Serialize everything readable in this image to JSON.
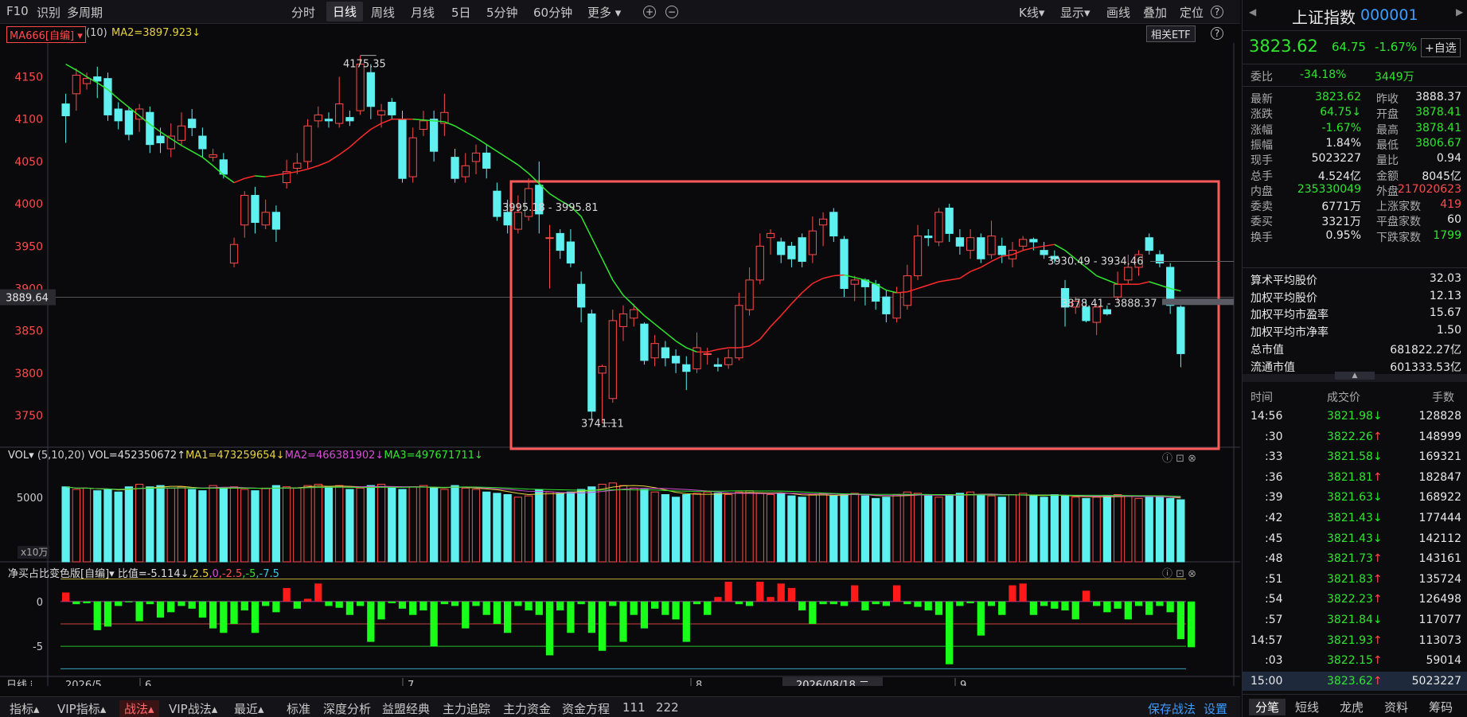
{
  "toolbar": {
    "f10": "F10",
    "identify": "识别",
    "multi_period": "多周期",
    "tabs": [
      "分时",
      "日线",
      "周线",
      "月线",
      "5日",
      "5分钟",
      "60分钟",
      "更多"
    ],
    "active_tab": "日线",
    "zoom_in": "+",
    "zoom_out": "−",
    "right_items": [
      "K线",
      "显示",
      "画线",
      "叠加",
      "定位"
    ],
    "help": "?"
  },
  "info": {
    "indicator_badge": "MA666[自编]",
    "period": "(10)",
    "ma2": "MA2=3897.923↓",
    "etf_button": "相关ETF"
  },
  "price_axis": {
    "labels": [
      "4150",
      "4100",
      "4050",
      "4000",
      "3950",
      "3900",
      "3850",
      "3800",
      "3750"
    ],
    "current": "3889.64"
  },
  "annotations": {
    "high": "4175.35",
    "low": "3741.11",
    "range1": "3995.18 - 3995.81",
    "range2": "3930.49 - 3934.46",
    "range3": "3878.41 - 3888.37"
  },
  "volume": {
    "label": "VOL",
    "params": "(5,10,20)",
    "vol": "VOL=452350672↑",
    "ma1": "MA1=473259654↓",
    "ma2": "MA2=466381902↓",
    "ma3": "MA3=497671711↓",
    "axis_label": "5000",
    "unit": "x10万"
  },
  "netbuy": {
    "label": "净买占比变色版[自编]",
    "ratio": "比值=-5.114↓",
    "levels": [
      "2.5",
      "0",
      "-2.5",
      "-5",
      "-7.5"
    ],
    "axis": [
      "0",
      "-5"
    ]
  },
  "xaxis": {
    "labels": [
      "2026/5",
      "6",
      "7",
      "8",
      "9"
    ],
    "cursor_date": "2026/08/18,二",
    "period": "日线"
  },
  "bottom": {
    "items": [
      "指标",
      "VIP指标",
      "战法",
      "VIP战法",
      "最近",
      "标准",
      "深度分析",
      "益盟经典",
      "主力追踪",
      "主力资金",
      "资金方程",
      "111",
      "222"
    ],
    "save": "保存战法",
    "settings": "设置"
  },
  "right": {
    "title": "上证指数",
    "code": "000001",
    "price": "3823.62",
    "change": "64.75",
    "pct": "-1.67%",
    "add_watch": "+自选",
    "wb": {
      "label": "委比",
      "val": "-34.18%",
      "val2": "3449万"
    },
    "kv": [
      [
        "最新",
        "3823.62",
        "昨收",
        "3888.37"
      ],
      [
        "涨跌",
        "64.75↓",
        "开盘",
        "3878.41"
      ],
      [
        "涨幅",
        "-1.67%",
        "最高",
        "3878.41"
      ],
      [
        "振幅",
        "1.84%",
        "最低",
        "3806.67"
      ],
      [
        "现手",
        "5023227",
        "量比",
        "0.94"
      ],
      [
        "总手",
        "4.524亿",
        "金额",
        "8045亿"
      ],
      [
        "内盘",
        "235330049",
        "外盘",
        "217020623"
      ],
      [
        "委卖",
        "6771万",
        "上涨家数",
        "419"
      ],
      [
        "委买",
        "3321万",
        "平盘家数",
        "60"
      ],
      [
        "换手",
        "0.95%",
        "下跌家数",
        "1799"
      ]
    ],
    "stats": [
      [
        "算术平均股价",
        "32.03"
      ],
      [
        "加权平均股价",
        "12.13"
      ],
      [
        "加权平均市盈率",
        "15.67"
      ],
      [
        "加权平均市净率",
        "1.50"
      ],
      [
        "总市值",
        "681822.27亿"
      ],
      [
        "流通市值",
        "601333.53亿"
      ]
    ],
    "ticks_header": [
      "时间",
      "成交价",
      "手数"
    ],
    "ticks": [
      [
        "14:56",
        "3821.98↓",
        "128828"
      ],
      [
        ":30",
        "3822.26↑",
        "148999"
      ],
      [
        ":33",
        "3821.58↓",
        "169321"
      ],
      [
        ":36",
        "3821.81↑",
        "182847"
      ],
      [
        ":39",
        "3821.63↓",
        "168922"
      ],
      [
        ":42",
        "3821.43↓",
        "177444"
      ],
      [
        ":45",
        "3821.43↓",
        "142112"
      ],
      [
        ":48",
        "3821.73↑",
        "143161"
      ],
      [
        ":51",
        "3821.83↑",
        "135724"
      ],
      [
        ":54",
        "3822.23↑",
        "126498"
      ],
      [
        ":57",
        "3821.84↓",
        "117077"
      ],
      [
        "14:57",
        "3821.93↑",
        "113073"
      ],
      [
        ":03",
        "3822.15↑",
        "59014"
      ],
      [
        "15:00",
        "3823.62↑",
        "5023227"
      ]
    ],
    "tabs": [
      "分笔",
      "短线",
      "龙虎",
      "资料",
      "筹码"
    ]
  },
  "chart_data": {
    "type": "candlestick",
    "title": "上证指数 000001 日线",
    "ylim": [
      3720,
      4190
    ],
    "candles": [
      [
        4118,
        4104,
        4130,
        4072
      ],
      [
        4130,
        4152,
        4160,
        4110
      ],
      [
        4142,
        4148,
        4155,
        4135
      ],
      [
        4150,
        4145,
        4162,
        4125
      ],
      [
        4148,
        4105,
        4155,
        4098
      ],
      [
        4112,
        4098,
        4120,
        4088
      ],
      [
        4110,
        4082,
        4115,
        4075
      ],
      [
        4100,
        4112,
        4118,
        4085
      ],
      [
        4108,
        4070,
        4115,
        4060
      ],
      [
        4080,
        4072,
        4090,
        4060
      ],
      [
        4065,
        4080,
        4095,
        4055
      ],
      [
        4075,
        4092,
        4108,
        4068
      ],
      [
        4100,
        4090,
        4112,
        4080
      ],
      [
        4080,
        4065,
        4090,
        4055
      ],
      [
        4055,
        4058,
        4065,
        4050
      ],
      [
        4052,
        4035,
        4060,
        4030
      ],
      [
        3930,
        3952,
        3960,
        3925
      ],
      [
        3975,
        4010,
        4015,
        3960
      ],
      [
        4010,
        3978,
        4020,
        3965
      ],
      [
        3975,
        3990,
        4005,
        3970
      ],
      [
        3990,
        3970,
        3998,
        3955
      ],
      [
        4025,
        4038,
        4052,
        4018
      ],
      [
        4042,
        4048,
        4060,
        4035
      ],
      [
        4050,
        4092,
        4100,
        4042
      ],
      [
        4098,
        4105,
        4115,
        4090
      ],
      [
        4100,
        4098,
        4108,
        4090
      ],
      [
        4095,
        4118,
        4150,
        4090
      ],
      [
        4102,
        4098,
        4110,
        4092
      ],
      [
        4110,
        4165,
        4175,
        4105
      ],
      [
        4155,
        4115,
        4165,
        4100
      ],
      [
        4105,
        4110,
        4118,
        4090
      ],
      [
        4120,
        4105,
        4125,
        4100
      ],
      [
        4100,
        4030,
        4110,
        4025
      ],
      [
        4032,
        4078,
        4090,
        4025
      ],
      [
        4088,
        4098,
        4110,
        4080
      ],
      [
        4100,
        4062,
        4110,
        4050
      ],
      [
        4095,
        4108,
        4130,
        4080
      ],
      [
        4055,
        4030,
        4065,
        4025
      ],
      [
        4032,
        4045,
        4060,
        4025
      ],
      [
        4050,
        4060,
        4070,
        4035
      ],
      [
        4060,
        4042,
        4070,
        4030
      ],
      [
        4015,
        3985,
        4025,
        3980
      ],
      [
        3990,
        3975,
        4005,
        3965
      ],
      [
        3970,
        3990,
        4010,
        3965
      ],
      [
        3985,
        4018,
        4030,
        3980
      ],
      [
        4022,
        3988,
        4050,
        3965
      ],
      [
        3960,
        3960,
        3975,
        3900
      ],
      [
        3965,
        3945,
        3970,
        3935
      ],
      [
        3955,
        3930,
        3970,
        3925
      ],
      [
        3905,
        3878,
        3920,
        3860
      ],
      [
        3870,
        3755,
        3875,
        3745
      ],
      [
        3800,
        3808,
        3810,
        3741
      ],
      [
        3770,
        3862,
        3875,
        3765
      ],
      [
        3855,
        3870,
        3880,
        3838
      ],
      [
        3865,
        3875,
        3882,
        3855
      ],
      [
        3858,
        3815,
        3860,
        3810
      ],
      [
        3818,
        3835,
        3845,
        3808
      ],
      [
        3830,
        3818,
        3838,
        3808
      ],
      [
        3820,
        3812,
        3828,
        3800
      ],
      [
        3810,
        3802,
        3820,
        3780
      ],
      [
        3805,
        3830,
        3848,
        3800
      ],
      [
        3822,
        3823,
        3830,
        3810
      ],
      [
        3810,
        3808,
        3818,
        3802
      ],
      [
        3810,
        3818,
        3828,
        3805
      ],
      [
        3818,
        3880,
        3895,
        3815
      ],
      [
        3875,
        3910,
        3925,
        3868
      ],
      [
        3910,
        3950,
        3965,
        3905
      ],
      [
        3960,
        3965,
        3970,
        3940
      ],
      [
        3955,
        3940,
        3960,
        3930
      ],
      [
        3950,
        3935,
        3955,
        3925
      ],
      [
        3960,
        3932,
        3965,
        3925
      ],
      [
        3940,
        3968,
        3985,
        3930
      ],
      [
        3975,
        3982,
        3990,
        3950
      ],
      [
        3990,
        3962,
        3995,
        3955
      ],
      [
        3958,
        3900,
        3962,
        3890
      ],
      [
        3905,
        3910,
        3915,
        3885
      ],
      [
        3910,
        3902,
        3912,
        3880
      ],
      [
        3905,
        3885,
        3910,
        3875
      ],
      [
        3890,
        3870,
        3898,
        3860
      ],
      [
        3865,
        3895,
        3902,
        3860
      ],
      [
        3880,
        3915,
        3928,
        3875
      ],
      [
        3915,
        3962,
        3975,
        3910
      ],
      [
        3962,
        3960,
        3970,
        3950
      ],
      [
        3955,
        3990,
        3995,
        3950
      ],
      [
        3995,
        3965,
        4000,
        3955
      ],
      [
        3960,
        3950,
        3970,
        3940
      ],
      [
        3945,
        3960,
        3970,
        3935
      ],
      [
        3960,
        3935,
        3965,
        3930
      ],
      [
        3940,
        3962,
        3980,
        3935
      ],
      [
        3950,
        3940,
        3960,
        3930
      ],
      [
        3935,
        3945,
        3955,
        3925
      ],
      [
        3950,
        3958,
        3962,
        3945
      ],
      [
        3958,
        3955,
        3960,
        3945
      ],
      [
        3945,
        3940,
        3955,
        3935
      ],
      [
        3938,
        3935,
        3945,
        3930
      ],
      [
        3900,
        3878,
        3910,
        3855
      ],
      [
        3878,
        3885,
        3890,
        3870
      ],
      [
        3878,
        3862,
        3885,
        3860
      ],
      [
        3860,
        3878,
        3882,
        3845
      ],
      [
        3875,
        3870,
        3880,
        3868
      ],
      [
        3890,
        3905,
        3920,
        3885
      ],
      [
        3910,
        3925,
        3940,
        3905
      ],
      [
        3925,
        3940,
        3945,
        3915
      ],
      [
        3960,
        3945,
        3965,
        3940
      ],
      [
        3940,
        3930,
        3945,
        3925
      ],
      [
        3925,
        3880,
        3930,
        3870
      ],
      [
        3878,
        3823,
        3880,
        3807
      ]
    ],
    "ma2": [
      4165,
      4158,
      4150,
      4143,
      4135,
      4124,
      4114,
      4104,
      4094,
      4085,
      4077,
      4069,
      4062,
      4055,
      4045,
      4034,
      4025,
      4030,
      4033,
      4032,
      4034,
      4036,
      4038,
      4041,
      4045,
      4050,
      4058,
      4067,
      4078,
      4088,
      4095,
      4100,
      4100,
      4100,
      4099,
      4098,
      4097,
      4092,
      4085,
      4078,
      4070,
      4062,
      4054,
      4046,
      4036,
      4024,
      4012,
      4004,
      3997,
      3985,
      3960,
      3935,
      3910,
      3892,
      3880,
      3868,
      3858,
      3848,
      3838,
      3830,
      3825,
      3825,
      3828,
      3830,
      3830,
      3832,
      3840,
      3855,
      3868,
      3882,
      3895,
      3906,
      3912,
      3915,
      3916,
      3913,
      3910,
      3905,
      3898,
      3895,
      3896,
      3900,
      3904,
      3908,
      3910,
      3912,
      3920,
      3925,
      3932,
      3938,
      3940,
      3945,
      3948,
      3950,
      3952,
      3945,
      3935,
      3925,
      3915,
      3910,
      3905,
      3905,
      3905,
      3908,
      3904,
      3900,
      3897
    ],
    "volume": {
      "ylim": [
        0,
        8000
      ],
      "values": [
        5800,
        5600,
        5700,
        5500,
        5600,
        5400,
        5800,
        6000,
        5800,
        5900,
        5700,
        5800,
        5600,
        5500,
        5900,
        5700,
        5800,
        5600,
        5500,
        5700,
        5900,
        5800,
        5700,
        5900,
        6000,
        5800,
        5900,
        5600,
        5700,
        5900,
        6000,
        5700,
        5600,
        5800,
        5900,
        5700,
        5600,
        5900,
        5700,
        5600,
        5400,
        5300,
        5200,
        5000,
        5100,
        5600,
        5400,
        5300,
        5400,
        5600,
        5800,
        6000,
        6100,
        5900,
        5700,
        5600,
        5400,
        5200,
        5000,
        5200,
        5300,
        5400,
        5300,
        5200,
        5400,
        5500,
        5300,
        5200,
        5300,
        5100,
        5000,
        5200,
        5300,
        5100,
        5200,
        5300,
        5100,
        4900,
        5000,
        5200,
        5400,
        5300,
        5100,
        5000,
        5200,
        5300,
        5400,
        5200,
        5100,
        5000,
        5200,
        5300,
        5100,
        5000,
        5200,
        5100,
        5000,
        4900,
        5000,
        5100,
        5200,
        5100,
        4900,
        5000,
        5100,
        4900,
        4800
      ]
    },
    "netbuy": {
      "ylim": [
        -8,
        3
      ],
      "values": [
        1.0,
        -0.3,
        -0.2,
        -3.2,
        -2.8,
        -0.5,
        -0.1,
        -2.2,
        -0.3,
        -1.8,
        -1.2,
        -0.5,
        -0.8,
        -1.8,
        -3.0,
        -3.5,
        -2.5,
        -1.0,
        -3.5,
        -0.5,
        -1.2,
        1.5,
        -0.8,
        0.3,
        2.0,
        -0.5,
        -0.7,
        -1.5,
        -0.5,
        -4.5,
        -2.0,
        -0.2,
        -0.8,
        -1.5,
        -1.0,
        -5.0,
        -0.3,
        -0.5,
        -3.0,
        -0.5,
        -1.5,
        -2.5,
        -3.5,
        -0.5,
        -1.0,
        -1.5,
        -6.0,
        -1.0,
        -3.5,
        -0.3,
        -3.5,
        -5.5,
        -0.5,
        -4.5,
        -1.5,
        -3.0,
        -0.8,
        -1.5,
        -2.0,
        -4.5,
        -0.3,
        -1.5,
        0.5,
        2.2,
        -0.3,
        -0.5,
        2.2,
        0.5,
        2.0,
        1.5,
        -1.0,
        -2.5,
        -0.3,
        -0.3,
        -0.5,
        1.8,
        -1.0,
        -0.3,
        -0.5,
        1.8,
        -0.3,
        -0.6,
        -1.0,
        -1.5,
        -7.0,
        -0.5,
        -0.2,
        -3.8,
        -0.5,
        -1.5,
        1.8,
        2.0,
        -1.5,
        -0.5,
        -0.8,
        -1.0,
        -2.0,
        1.2,
        -0.5,
        -1.2,
        -0.8,
        -2.0,
        -0.5,
        -1.5,
        -0.5,
        -1.2,
        -4.2,
        -5.1
      ]
    }
  }
}
